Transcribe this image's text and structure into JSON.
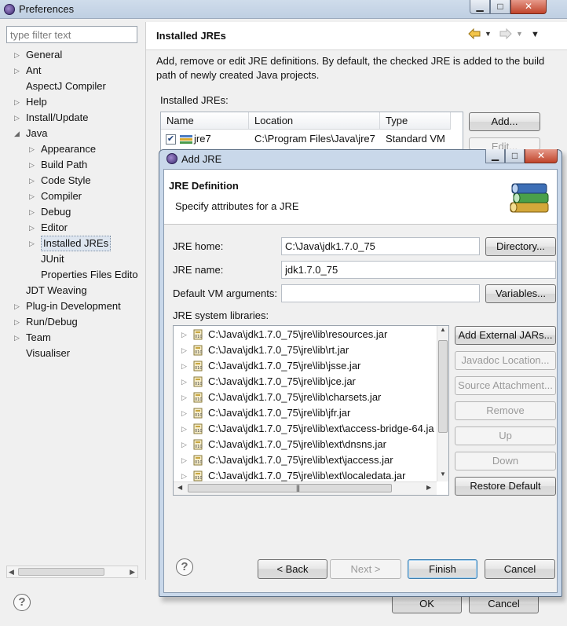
{
  "preferences": {
    "title": "Preferences",
    "window_buttons": {
      "minimize": "▁",
      "maximize": "□",
      "close": "✕"
    },
    "filter_placeholder": "type filter text",
    "tree": [
      {
        "label": "General",
        "expandable": true,
        "expanded": false,
        "level": 0
      },
      {
        "label": "Ant",
        "expandable": true,
        "expanded": false,
        "level": 0
      },
      {
        "label": "AspectJ Compiler",
        "expandable": false,
        "expanded": false,
        "level": 0
      },
      {
        "label": "Help",
        "expandable": true,
        "expanded": false,
        "level": 0
      },
      {
        "label": "Install/Update",
        "expandable": true,
        "expanded": false,
        "level": 0
      },
      {
        "label": "Java",
        "expandable": true,
        "expanded": true,
        "level": 0
      },
      {
        "label": "Appearance",
        "expandable": true,
        "expanded": false,
        "level": 1
      },
      {
        "label": "Build Path",
        "expandable": true,
        "expanded": false,
        "level": 1
      },
      {
        "label": "Code Style",
        "expandable": true,
        "expanded": false,
        "level": 1
      },
      {
        "label": "Compiler",
        "expandable": true,
        "expanded": false,
        "level": 1
      },
      {
        "label": "Debug",
        "expandable": true,
        "expanded": false,
        "level": 1
      },
      {
        "label": "Editor",
        "expandable": true,
        "expanded": false,
        "level": 1
      },
      {
        "label": "Installed JREs",
        "expandable": true,
        "expanded": false,
        "level": 1,
        "selected": true
      },
      {
        "label": "JUnit",
        "expandable": false,
        "expanded": false,
        "level": 1
      },
      {
        "label": "Properties Files Edito",
        "expandable": false,
        "expanded": false,
        "level": 1
      },
      {
        "label": "JDT Weaving",
        "expandable": false,
        "expanded": false,
        "level": 0
      },
      {
        "label": "Plug-in Development",
        "expandable": true,
        "expanded": false,
        "level": 0
      },
      {
        "label": "Run/Debug",
        "expandable": true,
        "expanded": false,
        "level": 0
      },
      {
        "label": "Team",
        "expandable": true,
        "expanded": false,
        "level": 0
      },
      {
        "label": "Visualiser",
        "expandable": false,
        "expanded": false,
        "level": 0
      }
    ],
    "page_title": "Installed JREs",
    "description": "Add, remove or edit JRE definitions. By default, the checked JRE is added to the build path of newly created Java projects.",
    "installed_label": "Installed JREs:",
    "table": {
      "columns": [
        "Name",
        "Location",
        "Type"
      ],
      "rows": [
        {
          "checked": true,
          "name": "jre7",
          "location": "C:\\Program Files\\Java\\jre7",
          "type": "Standard VM"
        }
      ]
    },
    "add_label": "Add...",
    "edit_label": "Edit...",
    "ok_label": "OK",
    "cancel_label": "Cancel",
    "help_glyph": "?",
    "nav_icons": [
      "back-arrow-icon",
      "forward-arrow-icon",
      "view-menu-icon"
    ]
  },
  "dialog": {
    "title": "Add JRE",
    "window_buttons": {
      "minimize": "▁",
      "maximize": "□",
      "close": "✕"
    },
    "header_title": "JRE Definition",
    "header_desc": "Specify attributes for a JRE",
    "jre_home_label": "JRE home:",
    "jre_home_value": "C:\\Java\\jdk1.7.0_75",
    "directory_label": "Directory...",
    "jre_name_label": "JRE name:",
    "jre_name_value": "jdk1.7.0_75",
    "vm_args_label": "Default VM arguments:",
    "vm_args_value": "",
    "variables_label": "Variables...",
    "libraries_label": "JRE system libraries:",
    "libraries": [
      "C:\\Java\\jdk1.7.0_75\\jre\\lib\\resources.jar",
      "C:\\Java\\jdk1.7.0_75\\jre\\lib\\rt.jar",
      "C:\\Java\\jdk1.7.0_75\\jre\\lib\\jsse.jar",
      "C:\\Java\\jdk1.7.0_75\\jre\\lib\\jce.jar",
      "C:\\Java\\jdk1.7.0_75\\jre\\lib\\charsets.jar",
      "C:\\Java\\jdk1.7.0_75\\jre\\lib\\jfr.jar",
      "C:\\Java\\jdk1.7.0_75\\jre\\lib\\ext\\access-bridge-64.ja",
      "C:\\Java\\jdk1.7.0_75\\jre\\lib\\ext\\dnsns.jar",
      "C:\\Java\\jdk1.7.0_75\\jre\\lib\\ext\\jaccess.jar",
      "C:\\Java\\jdk1.7.0_75\\jre\\lib\\ext\\localedata.jar"
    ],
    "buttons": {
      "add_external": "Add External JARs...",
      "javadoc": "Javadoc Location...",
      "source": "Source Attachment...",
      "remove": "Remove",
      "up": "Up",
      "down": "Down",
      "restore": "Restore Default"
    },
    "back_label": "< Back",
    "next_label": "Next >",
    "finish_label": "Finish",
    "cancel_label": "Cancel",
    "help_glyph": "?"
  }
}
